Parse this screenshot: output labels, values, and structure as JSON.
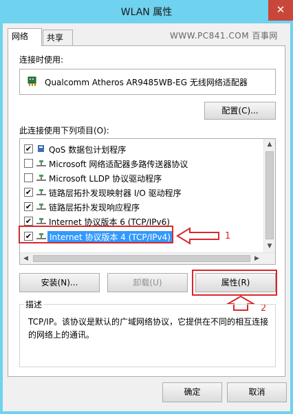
{
  "window": {
    "title": "WLAN 属性",
    "close_glyph": "✕"
  },
  "tabs": [
    {
      "label": "网络"
    },
    {
      "label": "共享"
    }
  ],
  "watermark": "WWW.PC841.COM 百事网",
  "connect_using_label": "连接时使用:",
  "adapter": {
    "name": "Qualcomm Atheros AR9485WB-EG 无线网络适配器",
    "icon": "network-adapter-icon"
  },
  "configure_button": "配置(C)...",
  "items_label": "此连接使用下列项目(O):",
  "items": [
    {
      "label": "QoS 数据包计划程序",
      "checked": true,
      "icon": "qos-icon"
    },
    {
      "label": "Microsoft 网络适配器多路传送器协议",
      "checked": false,
      "icon": "protocol-icon"
    },
    {
      "label": "Microsoft LLDP 协议驱动程序",
      "checked": false,
      "icon": "protocol-icon"
    },
    {
      "label": "链路层拓扑发现映射器 I/O 驱动程序",
      "checked": true,
      "icon": "protocol-icon"
    },
    {
      "label": "链路层拓扑发现响应程序",
      "checked": true,
      "icon": "protocol-icon"
    },
    {
      "label": "Internet 协议版本 6 (TCP/IPv6)",
      "checked": true,
      "icon": "protocol-icon"
    },
    {
      "label": "Internet 协议版本 4 (TCP/IPv4)",
      "checked": true,
      "icon": "protocol-icon",
      "selected": true
    }
  ],
  "buttons": {
    "install": "安装(N)...",
    "uninstall": "卸载(U)",
    "properties": "属性(R)",
    "ok": "确定",
    "cancel": "取消"
  },
  "description": {
    "legend": "描述",
    "text": "TCP/IP。该协议是默认的广域网络协议，它提供在不同的相互连接的网络上的通讯。"
  },
  "annotations": {
    "one": "1",
    "two": "2"
  },
  "colors": {
    "titlebar": "#6fd2ef",
    "close": "#c9473a",
    "selection": "#3399ff",
    "annotation_red": "#d9262c"
  }
}
